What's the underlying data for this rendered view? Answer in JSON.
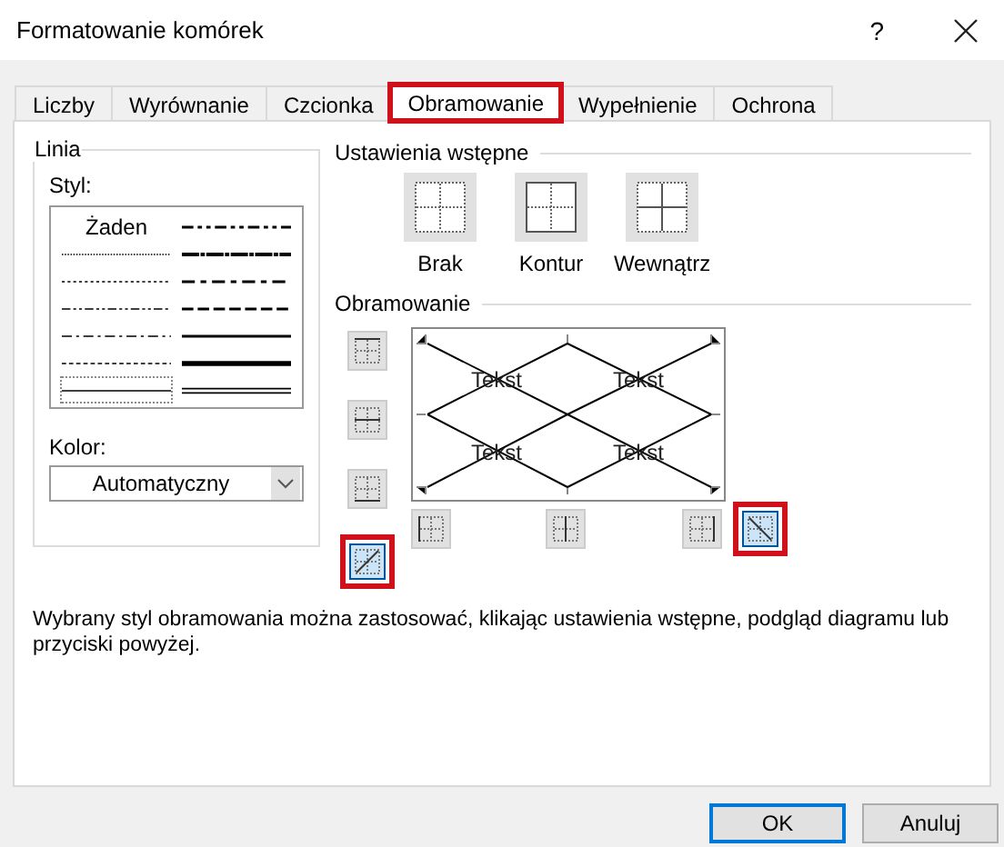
{
  "window": {
    "title": "Formatowanie komórek",
    "help": "?"
  },
  "tabs": [
    {
      "label": "Liczby",
      "selected": false,
      "highlighted": false
    },
    {
      "label": "Wyrównanie",
      "selected": false,
      "highlighted": false
    },
    {
      "label": "Czcionka",
      "selected": false,
      "highlighted": false
    },
    {
      "label": "Obramowanie",
      "selected": true,
      "highlighted": true
    },
    {
      "label": "Wypełnienie",
      "selected": false,
      "highlighted": false
    },
    {
      "label": "Ochrona",
      "selected": false,
      "highlighted": false
    }
  ],
  "line": {
    "title": "Linia",
    "style_label": "Styl:",
    "styles": [
      {
        "kind": "none",
        "label": "Żaden",
        "selected": false
      },
      {
        "kind": "hair",
        "selected": false
      },
      {
        "kind": "dotted",
        "selected": false
      },
      {
        "kind": "dash-dot-dot",
        "selected": false
      },
      {
        "kind": "dash-dot",
        "selected": false
      },
      {
        "kind": "dashed",
        "selected": false
      },
      {
        "kind": "thin",
        "selected": true
      },
      {
        "kind": "medium-dash-dot-dot",
        "selected": false
      },
      {
        "kind": "slant-dash-dot",
        "selected": false
      },
      {
        "kind": "medium-dash-dot",
        "selected": false
      },
      {
        "kind": "medium-dashed",
        "selected": false
      },
      {
        "kind": "medium",
        "selected": false
      },
      {
        "kind": "thick",
        "selected": false
      },
      {
        "kind": "double",
        "selected": false
      }
    ],
    "color_label": "Kolor:",
    "color_value": "Automatyczny"
  },
  "presets": {
    "title": "Ustawienia wstępne",
    "items": [
      {
        "kind": "none",
        "label": "Brak"
      },
      {
        "kind": "outline",
        "label": "Kontur"
      },
      {
        "kind": "inside",
        "label": "Wewnątrz"
      }
    ]
  },
  "border": {
    "title": "Obramowanie",
    "preview_texts": [
      "Tekst",
      "Tekst",
      "Tekst",
      "Tekst"
    ],
    "left_buttons": [
      {
        "kind": "top",
        "selected": false,
        "highlighted": false
      },
      {
        "kind": "middle",
        "selected": false,
        "highlighted": false
      },
      {
        "kind": "bottom",
        "selected": false,
        "highlighted": false
      },
      {
        "kind": "diag-up",
        "selected": true,
        "highlighted": true
      }
    ],
    "bottom_buttons": [
      {
        "kind": "left",
        "selected": false,
        "highlighted": false
      },
      {
        "kind": "center",
        "selected": false,
        "highlighted": false
      },
      {
        "kind": "right",
        "selected": false,
        "highlighted": false
      },
      {
        "kind": "diag-down",
        "selected": true,
        "highlighted": true
      }
    ]
  },
  "description": "Wybrany styl obramowania można zastosować, klikając ustawienia wstępne, podgląd diagramu lub przyciski powyżej.",
  "buttons": [
    {
      "label": "OK",
      "default": true
    },
    {
      "label": "Anuluj",
      "default": false
    }
  ]
}
